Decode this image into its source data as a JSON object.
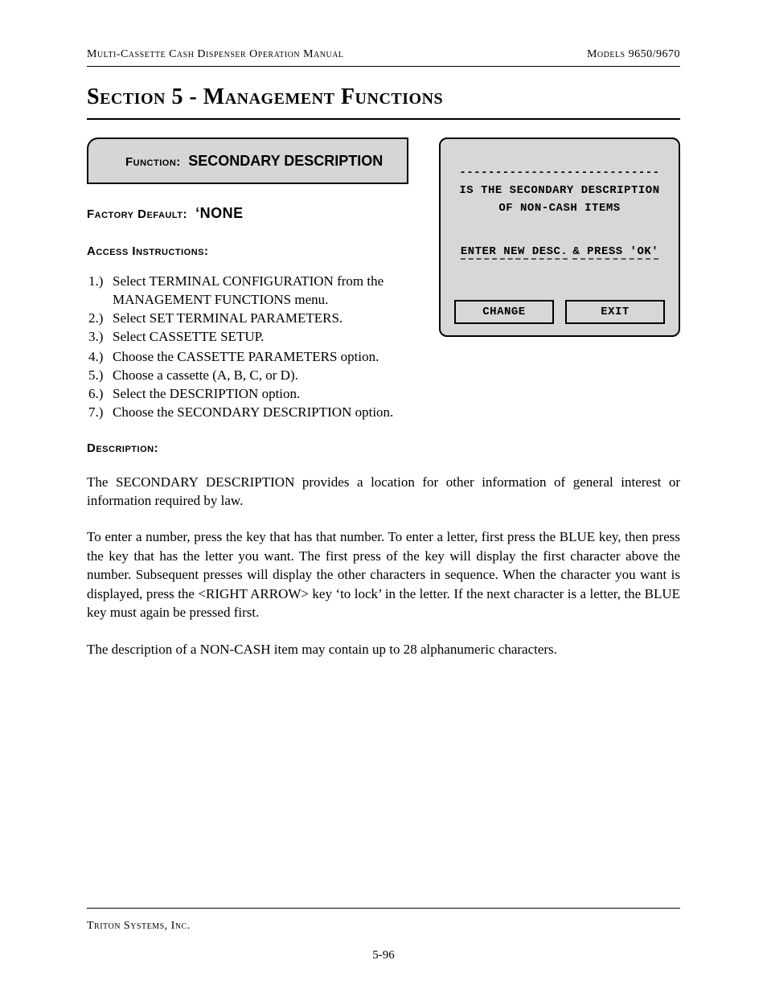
{
  "header": {
    "left": "Multi-Cassette Cash Dispenser Operation Manual",
    "right": "Models 9650/9670"
  },
  "section_title": "Section 5 - Management Functions",
  "function_label": "Function:",
  "function_name": "SECONDARY DESCRIPTION",
  "factory_default_label": "Factory Default:",
  "factory_default_value": "‘NONE",
  "access_instructions_label": "Access Instructions:",
  "steps": [
    {
      "n": "1.)",
      "t": "Select TERMINAL CONFIGURATION from the MANAGEMENT FUNCTIONS menu."
    },
    {
      "n": "2.)",
      "t": "Select SET TERMINAL PARAMETERS."
    },
    {
      "n": "3.)",
      "t": "Select CASSETTE SETUP."
    },
    {
      "n": "4.)",
      "t": "Choose the CASSETTE PARAMETERS option."
    },
    {
      "n": "5.)",
      "t": "Choose a cassette (A, B, C, or D)."
    },
    {
      "n": "6.)",
      "t": "Select the DESCRIPTION option."
    },
    {
      "n": "7.)",
      "t": "Choose the SECONDARY DESCRIPTION option."
    }
  ],
  "description_label": "Description:",
  "paragraphs": [
    "The SECONDARY DESCRIPTION provides a location for other information of general interest or information required by law.",
    "To enter a number, press the key that has that number.  To enter a letter, first press the BLUE key, then press the key that has the letter you want.  The first press of the key will display the first character above the number.  Subsequent presses will display the other characters in sequence.  When the character you want is displayed, press the <RIGHT ARROW> key ‘to lock’ in the letter.  If the next character is a letter, the BLUE key must again be pressed first.",
    "The description of a NON-CASH item may contain up to 28 alphanumeric characters."
  ],
  "terminal": {
    "dashes": "----------------------------",
    "line1": "IS THE SECONDARY DESCRIPTION",
    "line2": "OF NON-CASH ITEMS",
    "prompt_left": "ENTER NEW DESC.",
    "prompt_right": "& PRESS 'OK'",
    "change_label": "CHANGE",
    "exit_label": "EXIT"
  },
  "footer": {
    "company": "Triton Systems, Inc.",
    "page": "5-96"
  }
}
